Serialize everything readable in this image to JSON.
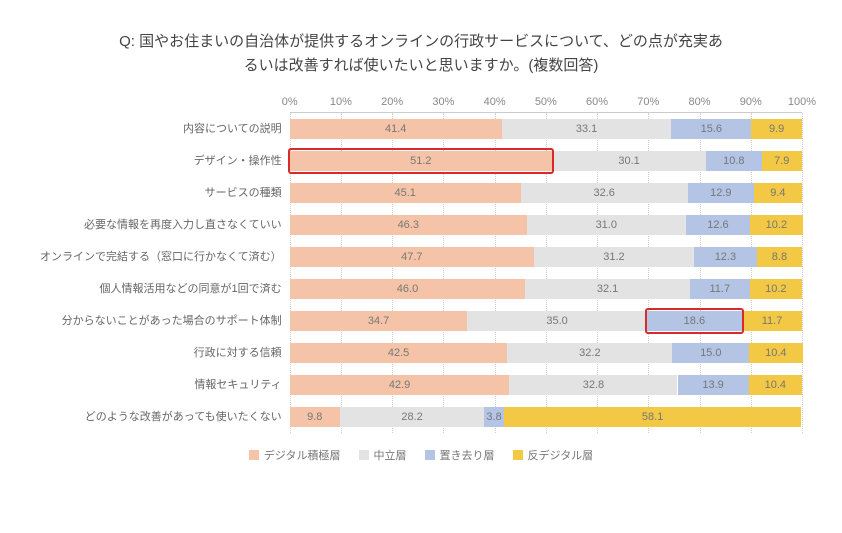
{
  "title_line1": "Q: 国やお住まいの自治体が提供するオンラインの行政サービスについて、どの点が充実あ",
  "title_line2": "るいは改善すれば使いたいと思いますか。(複数回答)",
  "legend": [
    {
      "label": "デジタル積極層",
      "cls": "c0"
    },
    {
      "label": "中立層",
      "cls": "c1"
    },
    {
      "label": "置き去り層",
      "cls": "c2"
    },
    {
      "label": "反デジタル層",
      "cls": "c3"
    }
  ],
  "xticks": [
    "0%",
    "10%",
    "20%",
    "30%",
    "40%",
    "50%",
    "60%",
    "70%",
    "80%",
    "90%",
    "100%"
  ],
  "chart_data": {
    "type": "bar",
    "stacked": true,
    "orientation": "horizontal",
    "xlabel": "",
    "ylabel": "",
    "xlim": [
      0,
      100
    ],
    "categories": [
      "内容についての説明",
      "デザイン・操作性",
      "サービスの種類",
      "必要な情報を再度入力し直さなくていい",
      "オンラインで完結する（窓口に行かなくて済む）",
      "個人情報活用などの同意が1回で済む",
      "分からないことがあった場合のサポート体制",
      "行政に対する信頼",
      "情報セキュリティ",
      "どのような改善があっても使いたくない"
    ],
    "series": [
      {
        "name": "デジタル積極層",
        "values": [
          41.4,
          51.2,
          45.1,
          46.3,
          47.7,
          46.0,
          34.7,
          42.5,
          42.9,
          9.8
        ]
      },
      {
        "name": "中立層",
        "values": [
          33.1,
          30.1,
          32.6,
          31.0,
          31.2,
          32.1,
          35.0,
          32.2,
          32.8,
          28.2
        ]
      },
      {
        "name": "置き去り層",
        "values": [
          15.6,
          10.8,
          12.9,
          12.6,
          12.3,
          11.7,
          18.6,
          15.0,
          13.9,
          3.8
        ]
      },
      {
        "name": "反デジタル層",
        "values": [
          9.9,
          7.9,
          9.4,
          10.2,
          8.8,
          10.2,
          11.7,
          10.4,
          10.4,
          58.1
        ]
      }
    ],
    "highlights": [
      {
        "row": 1,
        "series": 0,
        "note": "デザイン・操作性 デジタル積極層 highlighted"
      },
      {
        "row": 6,
        "series": 2,
        "note": "サポート体制 置き去り層 highlighted"
      }
    ]
  }
}
